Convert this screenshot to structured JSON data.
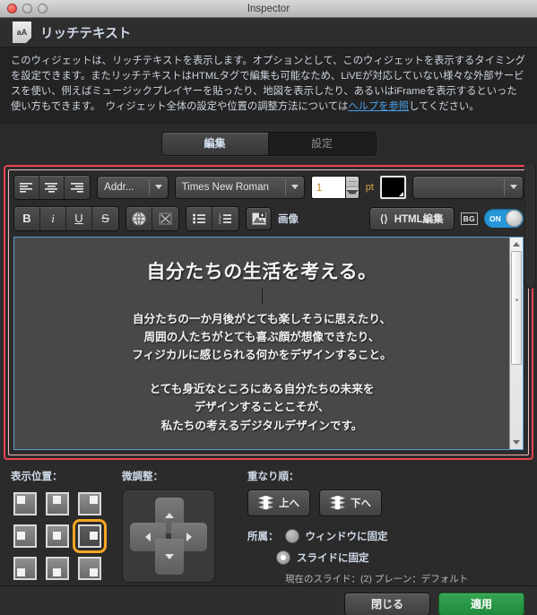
{
  "window": {
    "title": "Inspector",
    "traffic_lights": [
      "close-button",
      "minimize-button",
      "maximize-button"
    ]
  },
  "header": {
    "icon": "rich-text-widget-icon",
    "icon_text": "aA",
    "widget_title": "リッチテキスト"
  },
  "description": {
    "text_before_link": "このウィジェットは、リッチテキストを表示します。オプションとして、このウィジェットを表示するタイミングを設定できます。またリッチテキストはHTMLタグで編集も可能なため、LiVEが対応していない様々な外部サービスを使い、例えばミュージックプレイヤーを貼ったり、地図を表示したり、あるいはiFrameを表示するといった使い方もできます。　ウィジェット全体の設定や位置の調整方法については",
    "link_text": "ヘルプを参照",
    "text_after_link": "してください。",
    "link_color": "#4a9fe8"
  },
  "tabs": [
    {
      "label": "編集",
      "active": true
    },
    {
      "label": "設定",
      "active": false
    }
  ],
  "editor": {
    "annotation_border_color": "#e8454f",
    "toolbar_row1": {
      "align_buttons": [
        {
          "name": "align-left-button",
          "glyph": "≡"
        },
        {
          "name": "align-center-button",
          "glyph": "≡"
        },
        {
          "name": "align-right-button",
          "glyph": "≡"
        }
      ],
      "block_format": {
        "value": "Addr...",
        "name": "block-format-select"
      },
      "font_family": {
        "value": "Times New Roman",
        "name": "font-family-select"
      },
      "font_size": {
        "value": "1",
        "unit": "pt",
        "name": "font-size-stepper"
      },
      "text_color": {
        "value": "#000000",
        "name": "text-color-swatch"
      },
      "extra_style": {
        "value": "",
        "name": "style-select"
      }
    },
    "toolbar_row2": {
      "bold": "B",
      "italic": "i",
      "underline": "U",
      "strike": "S",
      "link_icon": "globe-icon",
      "unlink_icon": "unlink-icon",
      "bullet_list_icon": "bullet-list-icon",
      "numbered_list_icon": "numbered-list-icon",
      "image_icon": "image-icon",
      "image_label": "画像",
      "html_button": {
        "icon": "code-brackets-icon",
        "label": "HTML編集"
      },
      "bg_chip": "BG",
      "bg_toggle": {
        "label": "ON",
        "state": "on",
        "color": "#2596d8"
      }
    },
    "content": {
      "heading": "自分たちの生活を考える。",
      "paragraph1": [
        "自分たちの一か月後がとても楽しそうに思えたり、",
        "周囲の人たちがとても喜ぶ顔が想像できたり、",
        "フィジカルに感じられる何かをデザインすること。"
      ],
      "paragraph2": [
        "とても身近なところにある自分たちの未来を",
        "デザインすることこそが、",
        "私たちの考えるデジタルデザインです。"
      ]
    }
  },
  "position": {
    "label": "表示位置：",
    "cells": [
      {
        "name": "position-top-left",
        "selected": false
      },
      {
        "name": "position-top-center",
        "selected": false
      },
      {
        "name": "position-top-right",
        "selected": false
      },
      {
        "name": "position-middle-left",
        "selected": false
      },
      {
        "name": "position-middle-center",
        "selected": false
      },
      {
        "name": "position-middle-right",
        "selected": true
      },
      {
        "name": "position-bottom-left",
        "selected": false
      },
      {
        "name": "position-bottom-center",
        "selected": false
      },
      {
        "name": "position-bottom-right",
        "selected": false
      }
    ],
    "selected_highlight_color": "#f5a623"
  },
  "nudge": {
    "label": "微調整：",
    "buttons": [
      "nudge-up-button",
      "nudge-left-button",
      "nudge-right-button",
      "nudge-down-button"
    ]
  },
  "stacking": {
    "label": "重なり順：",
    "bring_forward": "上へ",
    "send_backward": "下へ"
  },
  "belonging": {
    "label": "所属：",
    "options": [
      {
        "label": "ウィンドウに固定",
        "selected": false
      },
      {
        "label": "スライドに固定",
        "selected": true
      }
    ],
    "slide_note": "現在のスライド：(2) プレーン：デフォルト"
  },
  "footer": {
    "close_label": "閉じる",
    "apply_label": "適用",
    "apply_color": "#2a9c48"
  }
}
